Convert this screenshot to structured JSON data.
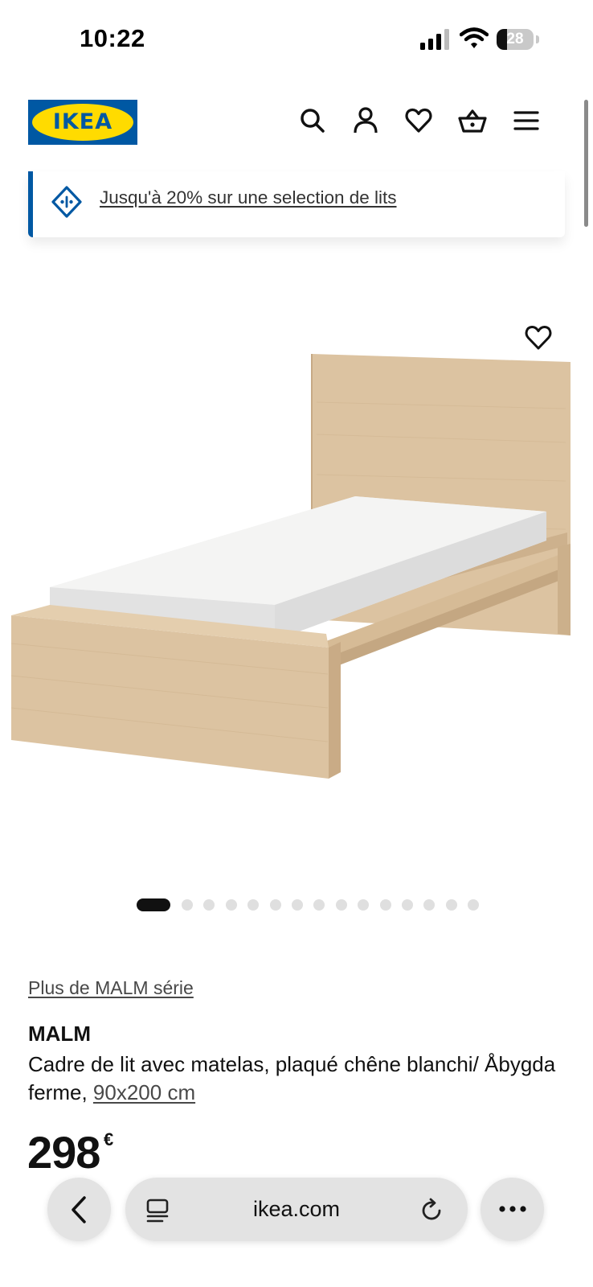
{
  "status_bar": {
    "time": "10:22",
    "battery_level": "28",
    "battery_fraction": 0.28
  },
  "header": {
    "logo_text": "IKEA",
    "icons": [
      "search-icon",
      "user-icon",
      "heart-icon",
      "basket-icon",
      "menu-icon"
    ]
  },
  "promo": {
    "icon": "tag-icon",
    "text": "Jusqu'à 20% sur une selection de lits"
  },
  "product_image": {
    "alt": "MALM bed frame with mattress",
    "favorite_icon": "heart-icon"
  },
  "carousel": {
    "total": 15,
    "active": 0
  },
  "product": {
    "series_link": "Plus de MALM série",
    "name": "MALM",
    "description": "Cadre de lit avec matelas, plaqué chêne blanchi/ Åbygda ferme, ",
    "size": "90x200 cm",
    "price": "298",
    "currency": "€"
  },
  "browser": {
    "url": "ikea.com",
    "icons": [
      "back-icon",
      "tabs-icon",
      "reload-icon",
      "more-icon"
    ]
  },
  "colors": {
    "ikea_blue": "#0058a3",
    "ikea_yellow": "#ffdb00",
    "wood": "#dcc3a1",
    "mattress": "#e9e9e9"
  }
}
